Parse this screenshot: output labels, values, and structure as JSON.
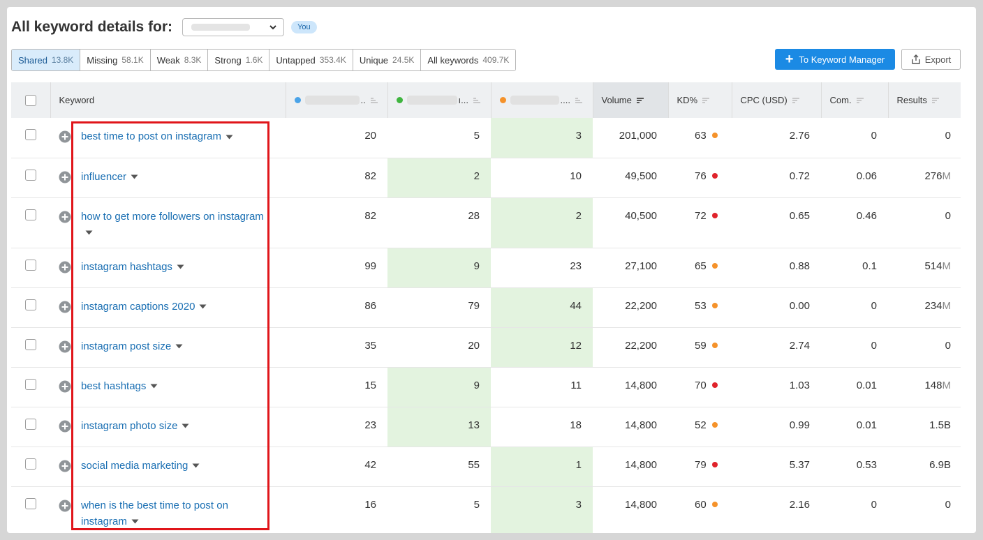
{
  "header": {
    "title": "All keyword details for:",
    "you_badge": "You"
  },
  "tabs": [
    {
      "label": "Shared",
      "count": "13.8K",
      "active": true
    },
    {
      "label": "Missing",
      "count": "58.1K",
      "active": false
    },
    {
      "label": "Weak",
      "count": "8.3K",
      "active": false
    },
    {
      "label": "Strong",
      "count": "1.6K",
      "active": false
    },
    {
      "label": "Untapped",
      "count": "353.4K",
      "active": false
    },
    {
      "label": "Unique",
      "count": "24.5K",
      "active": false
    },
    {
      "label": "All keywords",
      "count": "409.7K",
      "active": false
    }
  ],
  "actions": {
    "keyword_manager": "To Keyword Manager",
    "export": "Export"
  },
  "columns": {
    "keyword": "Keyword",
    "comp1_suffix": "..",
    "comp2_suffix": "ı...",
    "comp3_suffix": "....",
    "volume": "Volume",
    "kd": "KD%",
    "cpc": "CPC (USD)",
    "com": "Com.",
    "results": "Results"
  },
  "colors": {
    "comp1": "#4aa3e8",
    "comp2": "#3fb53f",
    "comp3": "#f5922a",
    "kd_orange": "#f5922a",
    "kd_red": "#e0232b",
    "highlight": "#e3f3df",
    "link": "#1a6fb3"
  },
  "rows": [
    {
      "keyword": "best time to post on instagram",
      "c1": "20",
      "c2": "5",
      "c3": "3",
      "hl": 3,
      "volume": "201,000",
      "kd": "63",
      "kd_color": "orange",
      "cpc": "2.76",
      "com": "0",
      "results": "0",
      "results_unit": ""
    },
    {
      "keyword": "influencer",
      "c1": "82",
      "c2": "2",
      "c3": "10",
      "hl": 2,
      "volume": "49,500",
      "kd": "76",
      "kd_color": "red",
      "cpc": "0.72",
      "com": "0.06",
      "results": "276",
      "results_unit": "M"
    },
    {
      "keyword": "how to get more followers on instagram",
      "c1": "82",
      "c2": "28",
      "c3": "2",
      "hl": 3,
      "volume": "40,500",
      "kd": "72",
      "kd_color": "red",
      "cpc": "0.65",
      "com": "0.46",
      "results": "0",
      "results_unit": ""
    },
    {
      "keyword": "instagram hashtags",
      "c1": "99",
      "c2": "9",
      "c3": "23",
      "hl": 2,
      "volume": "27,100",
      "kd": "65",
      "kd_color": "orange",
      "cpc": "0.88",
      "com": "0.1",
      "results": "514",
      "results_unit": "M"
    },
    {
      "keyword": "instagram captions 2020",
      "c1": "86",
      "c2": "79",
      "c3": "44",
      "hl": 3,
      "volume": "22,200",
      "kd": "53",
      "kd_color": "orange",
      "cpc": "0.00",
      "com": "0",
      "results": "234",
      "results_unit": "M"
    },
    {
      "keyword": "instagram post size",
      "c1": "35",
      "c2": "20",
      "c3": "12",
      "hl": 3,
      "volume": "22,200",
      "kd": "59",
      "kd_color": "orange",
      "cpc": "2.74",
      "com": "0",
      "results": "0",
      "results_unit": ""
    },
    {
      "keyword": "best hashtags",
      "c1": "15",
      "c2": "9",
      "c3": "11",
      "hl": 2,
      "volume": "14,800",
      "kd": "70",
      "kd_color": "red",
      "cpc": "1.03",
      "com": "0.01",
      "results": "148",
      "results_unit": "M"
    },
    {
      "keyword": "instagram photo size",
      "c1": "23",
      "c2": "13",
      "c3": "18",
      "hl": 2,
      "volume": "14,800",
      "kd": "52",
      "kd_color": "orange",
      "cpc": "0.99",
      "com": "0.01",
      "results": "1.5B",
      "results_unit": ""
    },
    {
      "keyword": "social media marketing",
      "c1": "42",
      "c2": "55",
      "c3": "1",
      "hl": 3,
      "volume": "14,800",
      "kd": "79",
      "kd_color": "red",
      "cpc": "5.37",
      "com": "0.53",
      "results": "6.9B",
      "results_unit": ""
    },
    {
      "keyword": "when is the best time to post on instagram",
      "c1": "16",
      "c2": "5",
      "c3": "3",
      "hl": 3,
      "volume": "14,800",
      "kd": "60",
      "kd_color": "orange",
      "cpc": "2.16",
      "com": "0",
      "results": "0",
      "results_unit": ""
    }
  ]
}
